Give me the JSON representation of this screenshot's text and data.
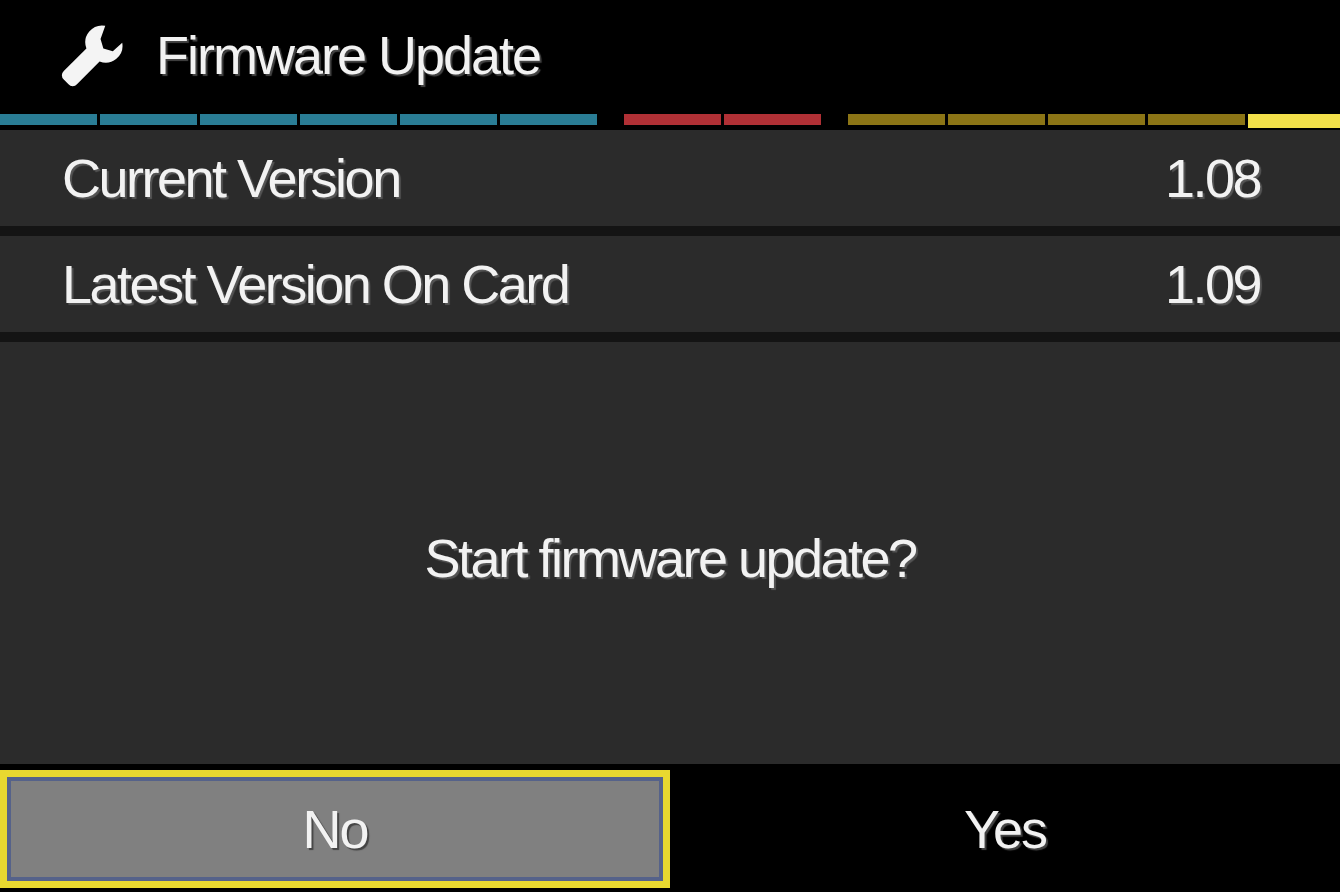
{
  "header": {
    "title": "Firmware Update"
  },
  "tab_strip": [
    {
      "color": "#2a7d95",
      "selected": false
    },
    {
      "color": "#2a7d95",
      "selected": false
    },
    {
      "color": "#2a7d95",
      "selected": false
    },
    {
      "color": "#2a7d95",
      "selected": false
    },
    {
      "color": "#2a7d95",
      "selected": false
    },
    {
      "color": "#2a7d95",
      "selected": false
    },
    {
      "color": "#b03035",
      "selected": false
    },
    {
      "color": "#b03035",
      "selected": false
    },
    {
      "color": "#8c7516",
      "selected": false
    },
    {
      "color": "#8c7516",
      "selected": false
    },
    {
      "color": "#8c7516",
      "selected": false
    },
    {
      "color": "#8c7516",
      "selected": false
    },
    {
      "color": "#f2e04a",
      "selected": true
    }
  ],
  "info_rows": [
    {
      "label": "Current Version",
      "value": "1.08"
    },
    {
      "label": "Latest Version On Card",
      "value": "1.09"
    }
  ],
  "prompt": "Start firmware update?",
  "buttons": [
    {
      "label": "No",
      "selected": true
    },
    {
      "label": "Yes",
      "selected": false
    }
  ]
}
